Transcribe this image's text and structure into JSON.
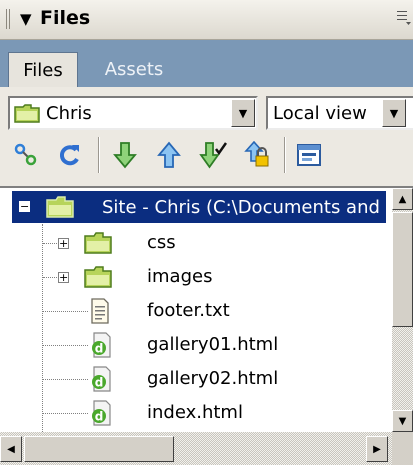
{
  "panel": {
    "title": "Files"
  },
  "tabs": [
    {
      "label": "Files"
    },
    {
      "label": "Assets"
    }
  ],
  "site_select": {
    "value": "Chris"
  },
  "view_select": {
    "value": "Local view"
  },
  "toolbar": [
    "connect-icon",
    "refresh-icon",
    "get-files-icon",
    "put-files-icon",
    "check-out-icon",
    "check-in-icon",
    "expand-icon"
  ],
  "tree": {
    "root": {
      "label": "Site - Chris (C:\\Documents and"
    },
    "items": [
      {
        "label": "css",
        "type": "folder"
      },
      {
        "label": "images",
        "type": "folder"
      },
      {
        "label": "footer.txt",
        "type": "text-file"
      },
      {
        "label": "gallery01.html",
        "type": "html-file"
      },
      {
        "label": "gallery02.html",
        "type": "html-file"
      },
      {
        "label": "index.html",
        "type": "html-file"
      }
    ]
  },
  "colors": {
    "selection": "#0b2d80",
    "tab_bar": "#7b98b6",
    "arrow_green": "#3aa23a",
    "arrow_blue": "#2f7fd8"
  }
}
